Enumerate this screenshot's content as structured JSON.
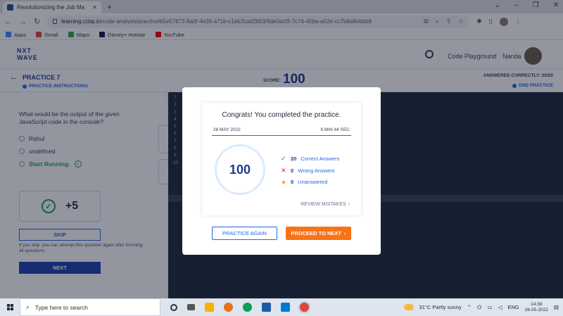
{
  "browser": {
    "tab_title": "Revolutionizing the Job Ma",
    "url_host": "learning.ccbp.in",
    "url_path": "/code-analysis/practice/b5e57873-8a0f-4e36-a71b-c1eb3cad2663/9de0acf3-7c74-45ba-a02e-cc7b8a9ebbb8",
    "bookmarks": [
      "Apps",
      "Gmail",
      "Maps",
      "Disney+ Hotstar",
      "YouTube"
    ]
  },
  "header": {
    "logo_line1": "NXT",
    "logo_line2": "WAVE",
    "playground": "Code Playground",
    "user": "Nanda"
  },
  "subheader": {
    "title": "PRACTICE 7",
    "instructions": "PRACTICE INSTRUCTIONS",
    "score_label": "SCORE:",
    "score": "100",
    "answered": "ANSWERED CORRECTLY: 20/20",
    "end": "END PRACTICE"
  },
  "question": {
    "text": "What would be the output of the given JavaScript code in the console?",
    "options": [
      "Rahul",
      "undefined",
      "Start Running."
    ],
    "points": "+5",
    "skip": "SKIP",
    "skip_note": "If you skip, you can attempt this question again after finishing all questions",
    "next": "NEXT"
  },
  "editor": {
    "line_numbers": "1\n2\n3\n4\n5\n6\n7\n8\n9\n10"
  },
  "modal": {
    "title": "Congrats! You completed the practice.",
    "date": "26 MAY 2022",
    "duration": "9 MIN 44 SEC",
    "score": "100",
    "correct_count": "20",
    "correct_label": "Correct Answers",
    "wrong_count": "0",
    "wrong_label": "Wrong Answers",
    "unanswered_count": "0",
    "unanswered_label": "Unanswered",
    "review": "REVIEW MISTAKES",
    "practice_again": "PRACTICE AGAIN",
    "proceed": "PROCEED TO NEXT"
  },
  "taskbar": {
    "search": "Type here to search",
    "weather": "31°C  Partly sunny",
    "lang": "ENG",
    "time": "14:38",
    "date": "26-05-2022"
  },
  "colors": {
    "primary_blue": "#1e3a8a",
    "accent_orange": "#f97316",
    "success_green": "#16a34a",
    "error_red": "#dc2626"
  }
}
